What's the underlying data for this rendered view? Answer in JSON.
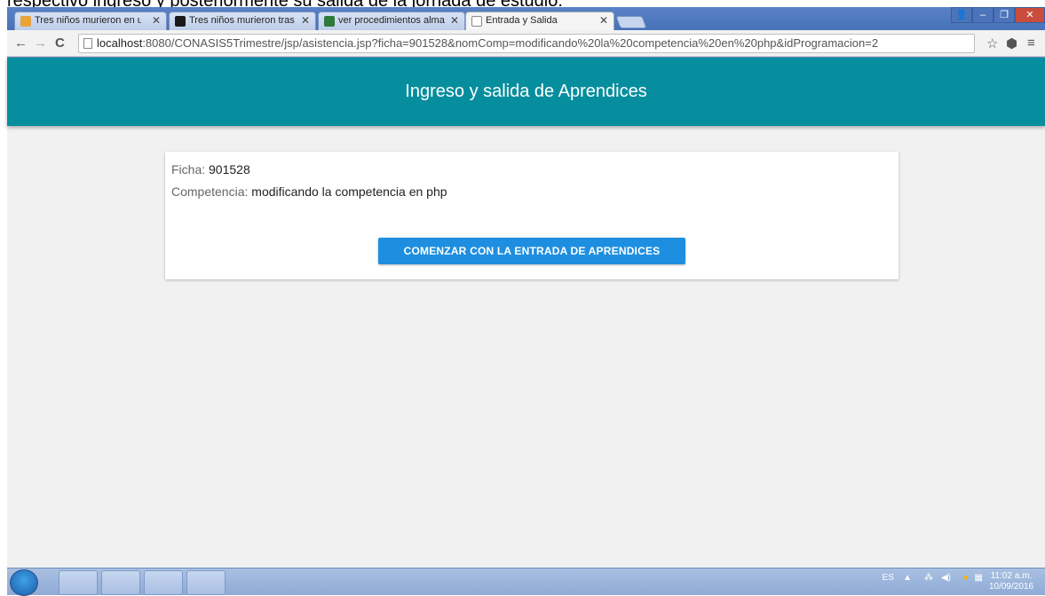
{
  "document_caption": "respectivo ingreso y posteriormente su salida de la jornada de estudio.",
  "browser": {
    "tabs": [
      {
        "label": "Tres niños murieron en un",
        "favicon_color": "#e8a33a",
        "active": false
      },
      {
        "label": "Tres niños murieron tras",
        "favicon_color": "#1a1a1a",
        "active": false
      },
      {
        "label": "ver procedimientos almac",
        "favicon_color": "#2f7a3a",
        "active": false
      },
      {
        "label": "Entrada y Salida",
        "favicon_color": "#ffffff",
        "active": true
      }
    ],
    "url_host": "localhost",
    "url_rest": ":8080/CONASIS5Trimestre/jsp/asistencia.jsp?ficha=901528&nomComp=modificando%20la%20competencia%20en%20php&idProgramacion=2"
  },
  "page": {
    "title": "Ingreso y salida de Aprendices",
    "ficha_label": "Ficha:",
    "ficha_value": "901528",
    "competencia_label": "Competencia:",
    "competencia_value": "modificando la competencia en php",
    "start_button": "COMENZAR CON LA ENTRADA DE APRENDICES"
  },
  "taskbar": {
    "lang": "ES",
    "time": "11:02 a.m.",
    "date": "10/09/2016"
  },
  "colors": {
    "appbar": "#068e9e",
    "button": "#1e8fe0",
    "page_bg": "#f1f1f1"
  }
}
